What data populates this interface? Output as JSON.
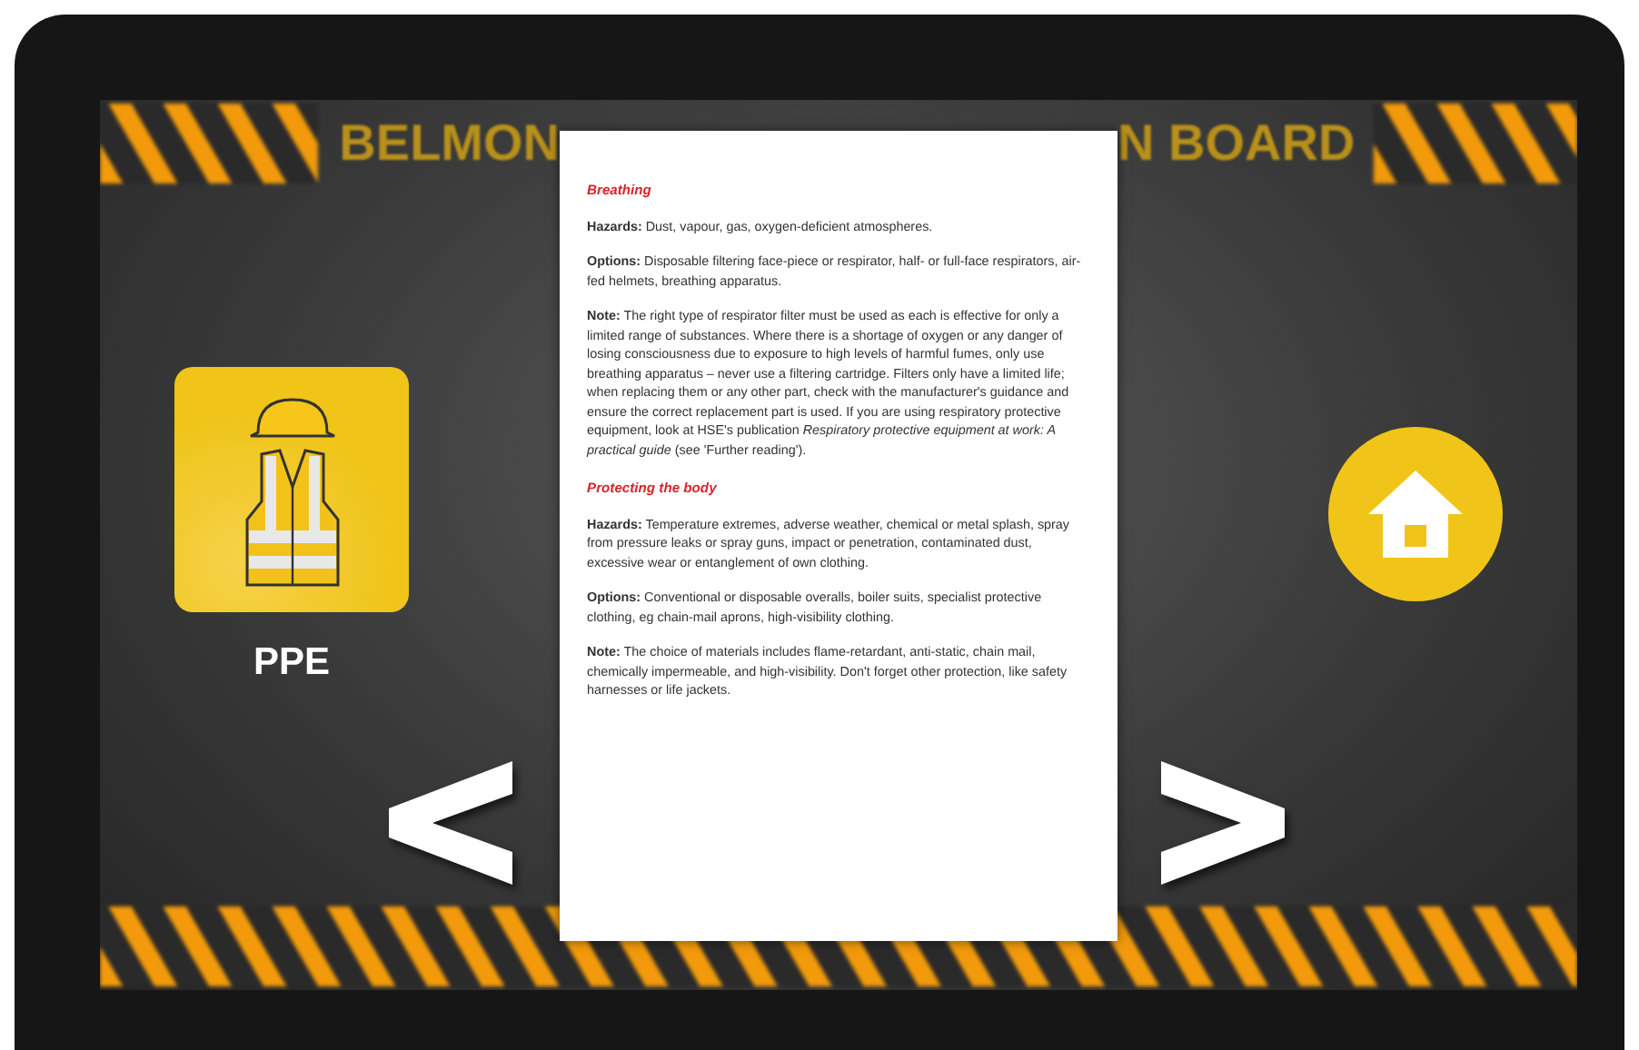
{
  "board_title": {
    "left_part": "BELMON",
    "right_part": "N BOARD"
  },
  "category": {
    "label": "PPE"
  },
  "document": {
    "sections": [
      {
        "heading": "Breathing",
        "paragraphs": [
          "**Hazards:** Dust, vapour, gas, oxygen-deficient atmospheres.",
          "**Options:** Disposable filtering face-piece or respirator, half- or full-face respirators, air-fed helmets, breathing apparatus.",
          "**Note:** The right type of respirator filter must be used as each is effective for only a limited range of substances. Where there is a shortage of oxygen or any danger of losing consciousness due to exposure to high levels of harmful fumes, only use breathing apparatus – never use a filtering cartridge. Filters only have a limited life; when replacing them or any other part, check with the manufacturer's guidance and ensure the correct replacement part is used. If you are using respiratory protective equipment, look at HSE's publication *Respiratory protective equipment at work: A practical guide* (see 'Further reading')."
        ]
      },
      {
        "heading": "Protecting the body",
        "paragraphs": [
          "**Hazards:** Temperature extremes, adverse weather, chemical or metal splash, spray from pressure leaks or spray guns, impact or penetration, contaminated dust, excessive wear or entanglement of own clothing.",
          "**Options:** Conventional or disposable overalls, boiler suits, specialist protective clothing, eg chain-mail aprons, high-visibility clothing.",
          "**Note:** The choice of materials includes flame-retardant, anti-static, chain mail, chemically impermeable, and high-visibility. Don't forget other protection, like safety harnesses or life jackets."
        ]
      }
    ]
  }
}
